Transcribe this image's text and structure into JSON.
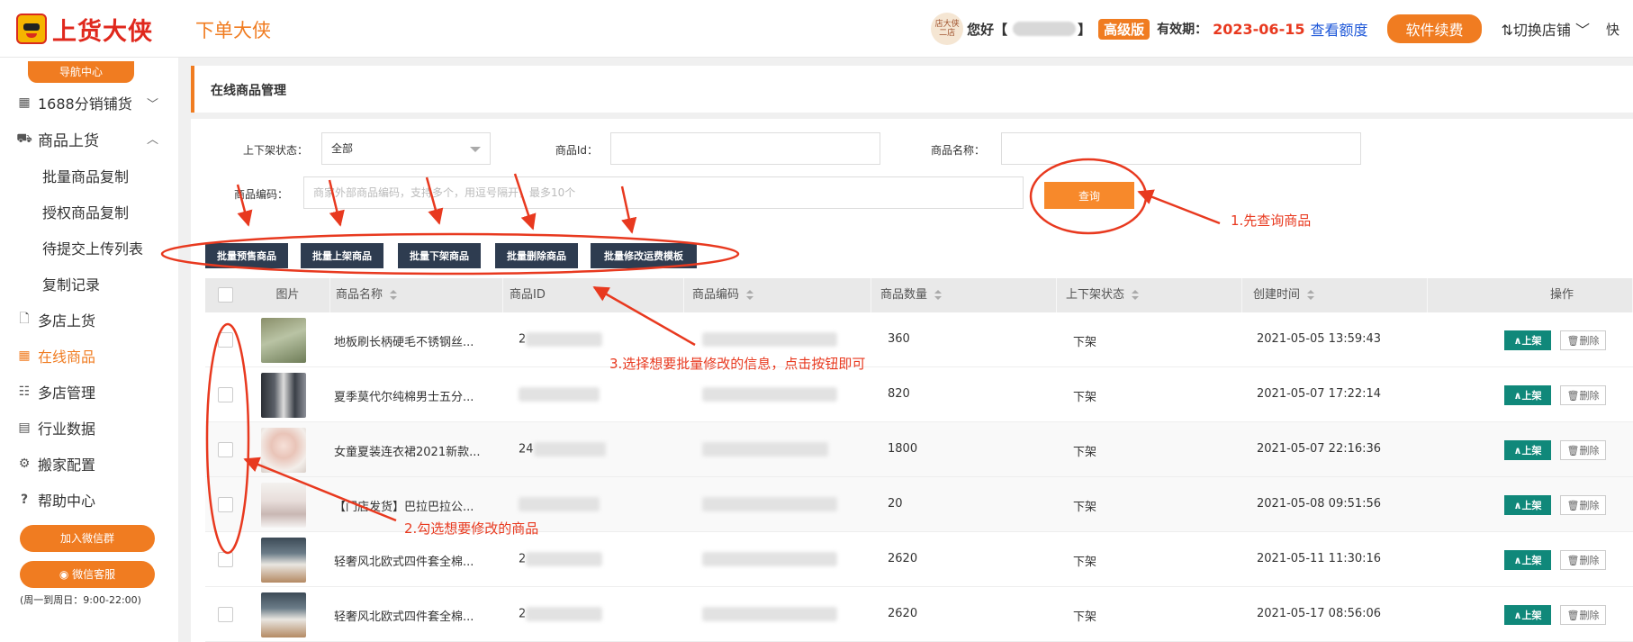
{
  "header": {
    "logo_text": "上货大侠",
    "sub_brand": "下单大侠",
    "store_avatar_text": "店大侠\n二店",
    "greeting": "您好【",
    "greeting_end": "】",
    "edition": "高级版",
    "valid_label": "有效期：",
    "valid_date": "2023-06-15",
    "quota_link": "查看额度",
    "renew_button": "软件续费",
    "switch_store": "⇅切换店铺 ﹀",
    "quick": "快"
  },
  "sidebar": {
    "nav_center": "导航中心",
    "items": [
      {
        "label": "1688分销铺货",
        "icon": "grid-icon"
      },
      {
        "label": "商品上货",
        "icon": "cart-icon"
      },
      {
        "label": "多店上货",
        "icon": "document-icon"
      },
      {
        "label": "在线商品",
        "icon": "grid-icon"
      },
      {
        "label": "多店管理",
        "icon": "network-icon"
      },
      {
        "label": "行业数据",
        "icon": "clipboard-icon"
      },
      {
        "label": "搬家配置",
        "icon": "gear-icon"
      },
      {
        "label": "帮助中心",
        "icon": "question-icon"
      }
    ],
    "sub_items": [
      "批量商品复制",
      "授权商品复制",
      "待提交上传列表",
      "复制记录"
    ],
    "join_wechat_group": "加入微信群",
    "wechat_service": "微信客服",
    "hours": "(周一到周日：9:00-22:00)",
    "active_item": "在线商品"
  },
  "page": {
    "title": "在线商品管理"
  },
  "filters": {
    "status_label": "上下架状态：",
    "status_value": "全部",
    "product_id_label": "商品Id：",
    "product_name_label": "商品名称：",
    "product_code_label": "商品编码：",
    "product_code_placeholder": "商家外部商品编码，支持多个，用逗号隔开，最多10个",
    "query_button": "查询"
  },
  "batch_actions": [
    "批量预售商品",
    "批量上架商品",
    "批量下架商品",
    "批量删除商品",
    "批量修改运费模板"
  ],
  "table": {
    "columns": [
      "图片",
      "商品名称",
      "商品ID",
      "商品编码",
      "商品数量",
      "上下架状态",
      "创建时间",
      "操作"
    ],
    "rows": [
      {
        "name": "地板刷长柄硬毛不锈钢丝...",
        "id_prefix": "2",
        "code_visible": "",
        "qty": "360",
        "status": "下架",
        "created": "2021-05-05 13:59:43"
      },
      {
        "name": "夏季莫代尔纯棉男士五分...",
        "id_prefix": "",
        "code_visible": "",
        "qty": "820",
        "status": "下架",
        "created": "2021-05-07 17:22:14"
      },
      {
        "name": "女童夏装连衣裙2021新款...",
        "id_prefix": "24",
        "code_visible": "",
        "qty": "1800",
        "status": "下架",
        "created": "2021-05-07 22:16:36"
      },
      {
        "name": "【门店发货】巴拉巴拉公...",
        "id_prefix": "",
        "code_visible": "",
        "qty": "20",
        "status": "下架",
        "created": "2021-05-08 09:51:56"
      },
      {
        "name": "轻奢风北欧式四件套全棉...",
        "id_prefix": "2",
        "code_visible": "",
        "qty": "2620",
        "status": "下架",
        "created": "2021-05-11 11:30:16"
      },
      {
        "name": "轻奢风北欧式四件套全棉...",
        "id_prefix": "2",
        "code_visible": "",
        "qty": "2620",
        "status": "下架",
        "created": "2021-05-17 08:56:06"
      }
    ],
    "up_button": "∧上架",
    "delete_button": "🗑删除"
  },
  "annotations": {
    "step1": "1.先查询商品",
    "step2": "2.勾选想要修改的商品",
    "step3": "3.选择想要批量修改的信息，点击按钮即可"
  },
  "colors": {
    "accent": "#f07c21",
    "annotation": "#e8391f",
    "dark_button": "#2e3c50",
    "up_button": "#10887a",
    "link": "#1d57d8"
  }
}
